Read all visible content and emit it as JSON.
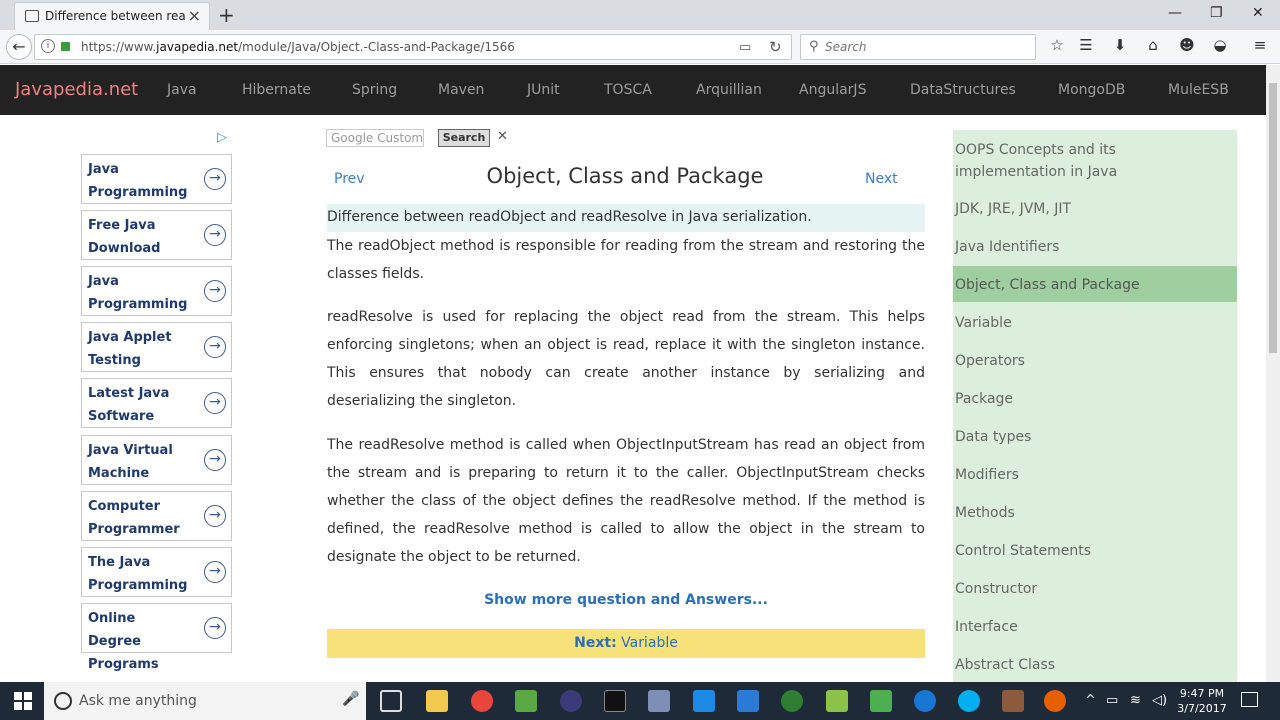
{
  "browser": {
    "tab_title": "Difference between readO...",
    "url_prefix": "https://www.",
    "url_domain": "javapedia.net",
    "url_path": "/module/Java/Object.-Class-and-Package/1566",
    "search_placeholder": "Search"
  },
  "site": {
    "brand": "Javapedia.net",
    "nav": [
      "Java",
      "Hibernate",
      "Spring",
      "Maven",
      "JUnit",
      "TOSCA",
      "Arquillian",
      "AngularJS",
      "DataStructures",
      "MongoDB",
      "MuleESB"
    ]
  },
  "ads": [
    "Java Programming",
    "Free Java Download",
    "Java Programming",
    "Java Applet Testing",
    "Latest Java Software",
    "Java Virtual Machine",
    "Computer Programmer",
    "The Java Programming",
    "Online Degree Programs"
  ],
  "main": {
    "gsearch_placeholder": "Google  Custom",
    "gsearch_button": "Search",
    "prev": "Prev",
    "next": "Next",
    "title": "Object, Class and Package",
    "question": "Difference between readObject and readResolve in Java serialization.",
    "paragraphs": [
      "The readObject method is responsible for reading from the stream and restoring the classes fields.",
      "readResolve is used for replacing the object read from the stream. This helps enforcing singletons; when an object is read, replace it with the singleton instance. This ensures that nobody can create another instance by serializing and deserializing the singleton.",
      "The readResolve method is called when ObjectInputStream has read an object from the stream and is preparing to return it to the caller. ObjectInputStream checks whether the class of the object defines the readResolve method. If the method is defined, the readResolve method is called to allow the object in the stream to designate the object to be returned."
    ],
    "show_more": "Show more question and Answers...",
    "next_label": "Next:",
    "next_topic": "Variable"
  },
  "sidebar": {
    "active": "Object, Class and Package",
    "items": [
      "OOPS Concepts and its implementation in Java",
      "JDK, JRE, JVM, JIT",
      "Java Identifiers",
      "Object, Class and Package",
      "Variable",
      "Operators",
      "Package",
      "Data types",
      "Modifiers",
      "Methods",
      "Control Statements",
      "Constructor",
      "Interface",
      "Abstract Class"
    ]
  },
  "taskbar": {
    "search_placeholder": "Ask me anything",
    "time": "9:47 PM",
    "date": "3/7/2017"
  }
}
